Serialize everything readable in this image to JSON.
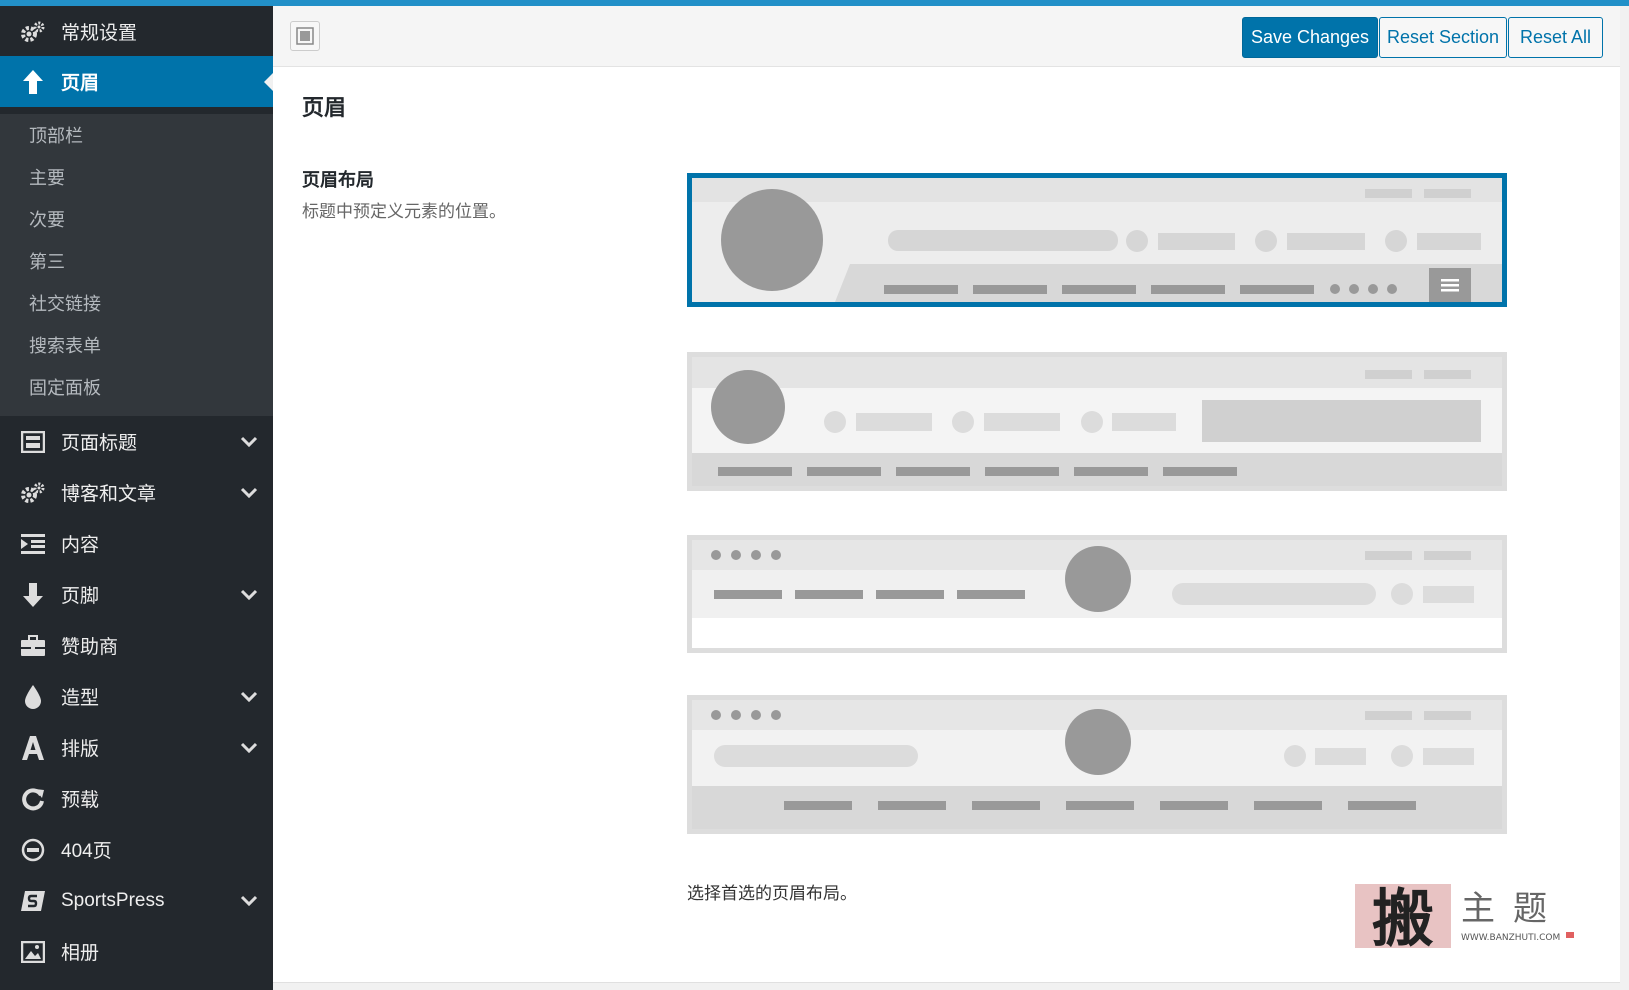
{
  "sidebar": {
    "top_items": [
      {
        "label": "常规设置",
        "icon": "gears-icon"
      },
      {
        "label": "页眉",
        "icon": "arrow-up-icon"
      }
    ],
    "sub_items": [
      "顶部栏",
      "主要",
      "次要",
      "第三",
      "社交链接",
      "搜索表单",
      "固定面板"
    ],
    "items": [
      {
        "label": "页面标题",
        "icon": "page-title-icon",
        "expandable": true
      },
      {
        "label": "博客和文章",
        "icon": "gears-icon",
        "expandable": true
      },
      {
        "label": "内容",
        "icon": "content-icon",
        "expandable": false
      },
      {
        "label": "页脚",
        "icon": "arrow-down-icon",
        "expandable": true
      },
      {
        "label": "赞助商",
        "icon": "briefcase-icon",
        "expandable": false
      },
      {
        "label": "造型",
        "icon": "drop-icon",
        "expandable": true
      },
      {
        "label": "排版",
        "icon": "typography-icon",
        "expandable": true
      },
      {
        "label": "预载",
        "icon": "refresh-icon",
        "expandable": false
      },
      {
        "label": "404页",
        "icon": "minus-circle-icon",
        "expandable": false
      },
      {
        "label": "SportsPress",
        "icon": "sportspress-icon",
        "expandable": true
      },
      {
        "label": "相册",
        "icon": "image-icon",
        "expandable": false
      },
      {
        "label": "",
        "icon": "page-title-icon",
        "expandable": false
      }
    ]
  },
  "toolbar": {
    "save_label": "Save Changes",
    "reset_section_label": "Reset Section",
    "reset_all_label": "Reset All"
  },
  "section": {
    "title": "页眉",
    "field_title": "页眉布局",
    "field_desc": "标题中预定义元素的位置。",
    "hint": "选择首选的页眉布局。"
  },
  "layouts": {
    "selected_index": 0,
    "count": 4
  },
  "watermark": {
    "big": "搬",
    "small": "主题",
    "url": "WWW.BANZHUTI.COM"
  },
  "colors": {
    "sidebar_bg": "#23282d",
    "sidebar_sub_bg": "#32373c",
    "accent": "#0073aa",
    "top_line": "#2290c8"
  }
}
